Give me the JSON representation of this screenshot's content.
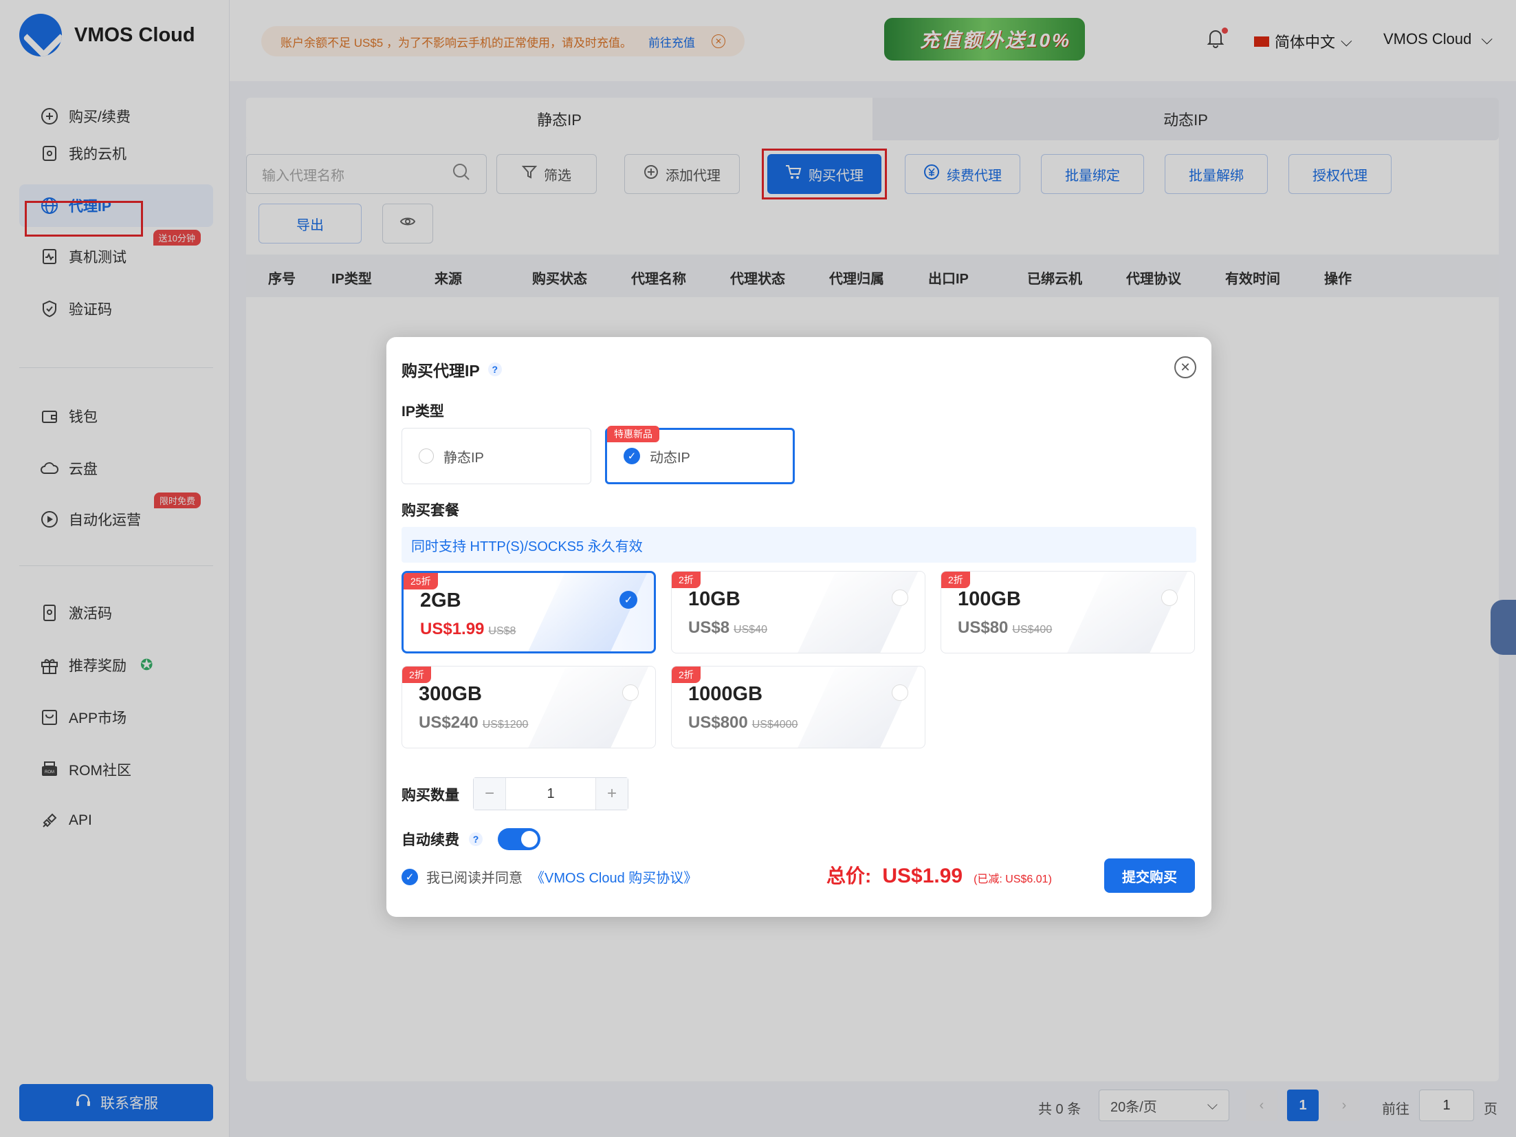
{
  "app": {
    "name": "VMOS Cloud"
  },
  "sidebar": {
    "items": [
      {
        "label": "购买/续费",
        "icon": "plus-circle-icon"
      },
      {
        "label": "我的云机",
        "icon": "phone-icon"
      },
      {
        "label": "代理IP",
        "icon": "globe-icon"
      },
      {
        "label": "真机测试",
        "icon": "pulse-icon",
        "tag": "送10分钟"
      },
      {
        "label": "验证码",
        "icon": "shield-icon"
      },
      {
        "label": "钱包",
        "icon": "wallet-icon"
      },
      {
        "label": "云盘",
        "icon": "cloud-icon"
      },
      {
        "label": "自动化运营",
        "icon": "play-circle-icon",
        "tag": "限时免费"
      },
      {
        "label": "激活码",
        "icon": "activation-icon"
      },
      {
        "label": "推荐奖励",
        "icon": "gift-icon"
      },
      {
        "label": "APP市场",
        "icon": "app-market-icon"
      },
      {
        "label": "ROM社区",
        "icon": "rom-icon"
      },
      {
        "label": "API",
        "icon": "api-icon"
      }
    ],
    "contact": "联系客服"
  },
  "topbar": {
    "notice": "账户余额不足 US$5 ，为了不影响云手机的正常使用，请及时充值。",
    "notice_link": "前往充值",
    "promo": "充值额外送10%",
    "language": "简体中文",
    "account": "VMOS Cloud"
  },
  "tabs": {
    "static": "静态IP",
    "dynamic": "动态IP"
  },
  "toolbar": {
    "search_placeholder": "输入代理名称",
    "filter": "筛选",
    "add": "添加代理",
    "buy": "购买代理",
    "renew": "续费代理",
    "batch_bind": "批量绑定",
    "batch_unbind": "批量解绑",
    "authorize": "授权代理",
    "export": "导出"
  },
  "table": {
    "columns": [
      "序号",
      "IP类型",
      "来源",
      "购买状态",
      "代理名称",
      "代理状态",
      "代理归属",
      "出口IP",
      "已绑云机",
      "代理协议",
      "有效时间",
      "操作"
    ]
  },
  "pagination": {
    "total": "共 0 条",
    "page_size": "20条/页",
    "current": "1",
    "goto_label": "前往",
    "goto_value": "1",
    "page_suffix": "页"
  },
  "modal": {
    "title": "购买代理IP",
    "ip_type_label": "IP类型",
    "ip_types": [
      {
        "label": "静态IP",
        "selected": false
      },
      {
        "label": "动态IP",
        "selected": true,
        "badge": "特惠新品"
      }
    ],
    "package_label": "购买套餐",
    "package_info": "同时支持 HTTP(S)/SOCKS5 永久有效",
    "packages": [
      {
        "size": "2GB",
        "price": "US$1.99",
        "original": "US$8",
        "badge": "25折",
        "selected": true
      },
      {
        "size": "10GB",
        "price": "US$8",
        "original": "US$40",
        "badge": "2折",
        "selected": false
      },
      {
        "size": "100GB",
        "price": "US$80",
        "original": "US$400",
        "badge": "2折",
        "selected": false
      },
      {
        "size": "300GB",
        "price": "US$240",
        "original": "US$1200",
        "badge": "2折",
        "selected": false
      },
      {
        "size": "1000GB",
        "price": "US$800",
        "original": "US$4000",
        "badge": "2折",
        "selected": false
      }
    ],
    "quantity_label": "购买数量",
    "quantity": "1",
    "auto_renew_label": "自动续费",
    "auto_renew": true,
    "agree_text": "我已阅读并同意",
    "agree_link": "《VMOS Cloud 购买协议》",
    "total_label": "总价:",
    "total_value": "US$1.99",
    "saved": "(已减: US$6.01)",
    "submit": "提交购买"
  },
  "colors": {
    "accent": "#1a6fe8",
    "danger": "#e8262a"
  }
}
